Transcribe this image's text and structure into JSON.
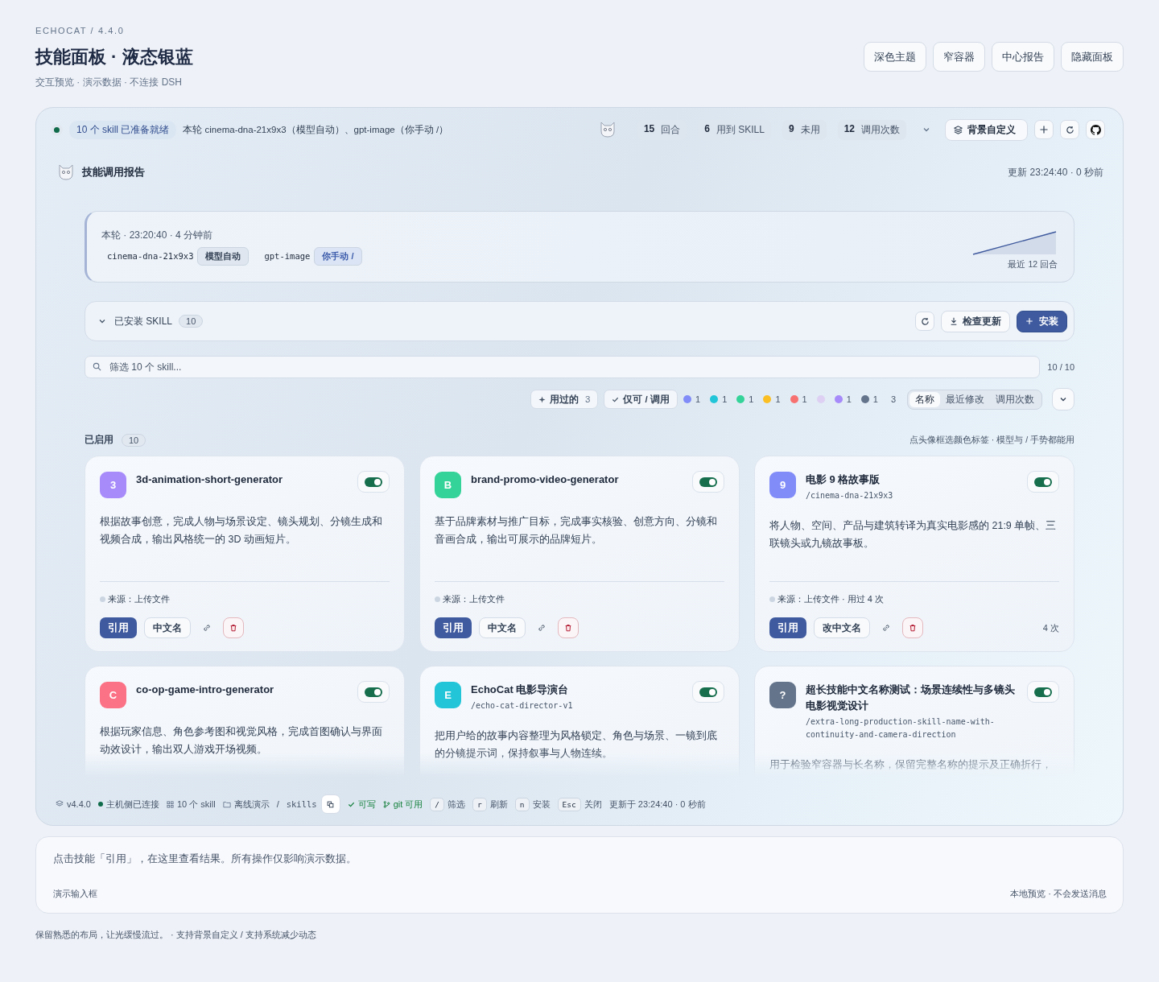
{
  "header": {
    "eyebrow": "ECHOCAT / 4.4.0",
    "title": "技能面板 · 液态银蓝",
    "subtitle": "交互预览 · 演示数据 · 不连接 DSH",
    "buttons": [
      "深色主题",
      "窄容器",
      "中心报告",
      "隐藏面板"
    ]
  },
  "topbar": {
    "connected": true,
    "ready": "10 个 skill 已准备就绪",
    "summary": "本轮 cinema-dna-21x9x3（模型自动）、gpt-image（你手动 /）",
    "stats": [
      {
        "value": "15",
        "label": "回合"
      },
      {
        "value": "6",
        "label": "用到 SKILL"
      },
      {
        "value": "9",
        "label": "未用"
      },
      {
        "value": "12",
        "label": "调用次数"
      }
    ],
    "background_button": "背景自定义"
  },
  "report": {
    "title": "技能调用报告",
    "updated": "更新 23:24:40 · 0 秒前",
    "round_time": "本轮 · 23:20:40 · 4 分钟前",
    "calls": [
      {
        "name": "cinema-dna-21x9x3",
        "tag": "模型自动",
        "kind": "auto"
      },
      {
        "name": "gpt-image",
        "tag": "你手动 /",
        "kind": "manual"
      }
    ],
    "trend_label": "最近 12 回合"
  },
  "installed": {
    "expanded": true,
    "title": "已安装 SKILL",
    "count": "10",
    "check_button": "检查更新",
    "install_button": "安装"
  },
  "search": {
    "placeholder": "筛选 10 个 skill...",
    "count": "10 / 10"
  },
  "filters": {
    "used_button": {
      "label": "用过的",
      "count": "3"
    },
    "callable_button": "仅可 / 调用",
    "tags": [
      {
        "color": "#818cf8",
        "count": "1"
      },
      {
        "color": "#22c5d8",
        "count": "1"
      },
      {
        "color": "#34d399",
        "count": "1"
      },
      {
        "color": "#fbbf24",
        "count": "1"
      },
      {
        "color": "#f87171",
        "count": "1"
      },
      {
        "color": "#ddd0f3"
      },
      {
        "color": "#a78bfa",
        "count": "1"
      },
      {
        "color": "#64748b",
        "count": "1"
      }
    ],
    "untagged_count": "3",
    "sort": [
      {
        "label": "名称",
        "selected": true
      },
      {
        "label": "最近修改",
        "selected": false
      },
      {
        "label": "调用次数",
        "selected": false
      }
    ]
  },
  "enabled_section": {
    "title": "已启用",
    "count": "10",
    "hint": "点头像框选颜色标签 · 模型与 / 手势都能用"
  },
  "cards": [
    {
      "avatar": "3",
      "color": "#a78bfa",
      "title": "3d-animation-short-generator",
      "description": "根据故事创意，完成人物与场景设定、镜头规划、分镜生成和视频合成，输出风格统一的 3D 动画短片。",
      "enabled": true,
      "meta": "来源：上传文件",
      "cite_button": "引用",
      "rename_button": "中文名"
    },
    {
      "avatar": "B",
      "color": "#34d399",
      "title": "brand-promo-video-generator",
      "description": "基于品牌素材与推广目标，完成事实核验、创意方向、分镜和音画合成，输出可展示的品牌短片。",
      "enabled": true,
      "meta": "来源：上传文件",
      "cite_button": "引用",
      "rename_button": "中文名"
    },
    {
      "avatar": "9",
      "color": "#818cf8",
      "title": "电影 9 格故事版",
      "slug": "/cinema-dna-21x9x3",
      "description": "将人物、空间、产品与建筑转译为真实电影感的 21:9 单帧、三联镜头或九镜故事板。",
      "enabled": true,
      "meta": "来源：上传文件 · 用过 4 次",
      "cite_button": "引用",
      "rename_button": "改中文名",
      "uses": "4 次"
    },
    {
      "avatar": "C",
      "color": "#fb7185",
      "title": "co-op-game-intro-generator",
      "description": "根据玩家信息、角色参考图和视觉风格，完成首图确认与界面动效设计，输出双人游戏开场视频。",
      "enabled": true
    },
    {
      "avatar": "E",
      "color": "#22c5d8",
      "title": "EchoCat 电影导演台",
      "slug": "/echo-cat-director-v1",
      "description": "把用户给的故事内容整理为风格锁定、角色与场景、一镜到底的分镜提示词，保持叙事与人物连续。",
      "enabled": true
    },
    {
      "avatar": "?",
      "color": "#64748b",
      "title": "超长技能中文名称测试：场景连续性与多镜头电影视觉设计",
      "slug": "/extra-long-production-skill-name-with-continuity-and-camera-direction",
      "description": "用于检验窄容器与长名称，保留完整名称的提示及正确折行，",
      "enabled": true
    }
  ],
  "status_bar": {
    "version": "v4.4.0",
    "host": "主机侧已连接",
    "host_connected": true,
    "skills": "10 个 skill",
    "mode": "离线演示",
    "separator": "/",
    "path": "skills",
    "writable": "可写",
    "git": "git 可用",
    "shortcuts": [
      {
        "key": "/",
        "label": "筛选"
      },
      {
        "key": "r",
        "label": "刷新"
      },
      {
        "key": "n",
        "label": "安装"
      },
      {
        "key": "Esc",
        "label": "关闭"
      }
    ],
    "updated": "更新于 23:24:40 · 0 秒前"
  },
  "composer": {
    "message": "点击技能「引用」，在这里查看结果。所有操作仅影响演示数据。",
    "label": "演示输入框",
    "note": "本地预览 · 不会发送消息"
  },
  "footer": "保留熟悉的布局，让光缓慢流过。 · 支持背景自定义 / 支持系统减少动态"
}
